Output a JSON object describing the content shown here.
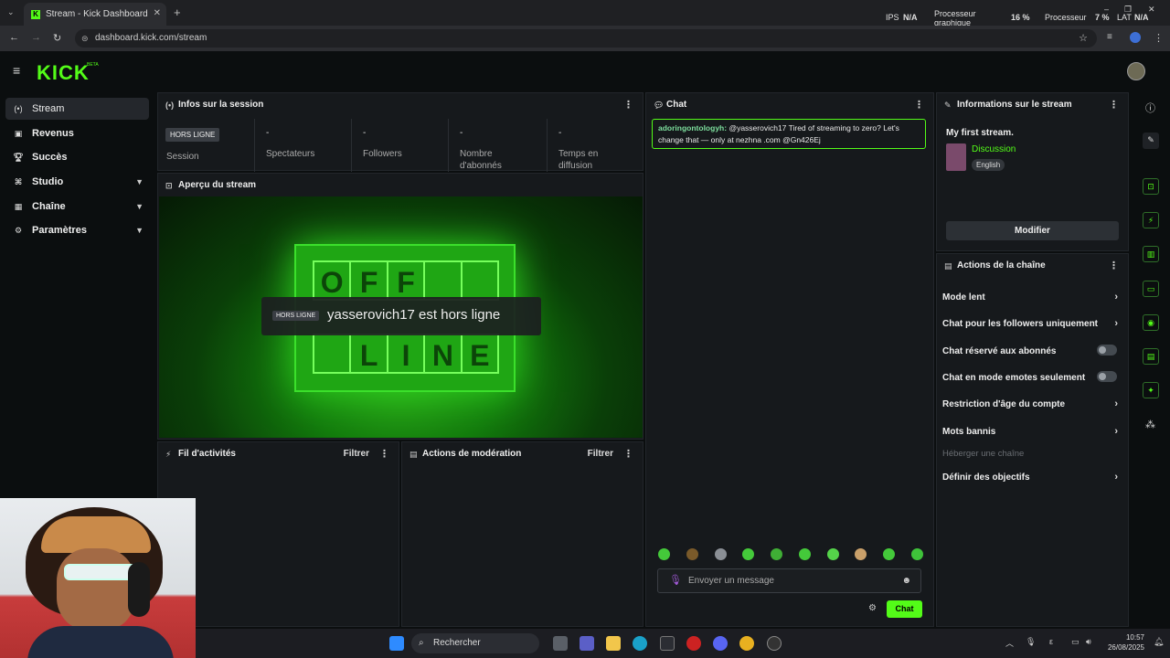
{
  "browser": {
    "tab_title": "Stream - Kick Dashboard",
    "url": "dashboard.kick.com/stream",
    "perf": {
      "ips_label": "IPS",
      "ips_value": "N/A",
      "gpu_label": "Processeur graphique",
      "gpu_value": "16 %",
      "cpu_label": "Processeur",
      "cpu_value": "7 %",
      "lat_label": "LAT",
      "lat_value": "N/A"
    }
  },
  "app": {
    "logo": "KICK",
    "beta": "BETA"
  },
  "sidebar": {
    "items": [
      {
        "label": "Stream",
        "icon": "broadcast-icon"
      },
      {
        "label": "Revenus",
        "icon": "wallet-icon"
      },
      {
        "label": "Succès",
        "icon": "trophy-icon"
      },
      {
        "label": "Studio",
        "icon": "studio-icon"
      },
      {
        "label": "Chaîne",
        "icon": "channel-icon"
      },
      {
        "label": "Paramètres",
        "icon": "gear-icon"
      }
    ]
  },
  "session": {
    "title": "Infos sur la session",
    "badge": "HORS LIGNE",
    "session_label": "Session",
    "stats": [
      {
        "value": "-",
        "label": "Spectateurs"
      },
      {
        "value": "-",
        "label": "Followers"
      },
      {
        "value": "-",
        "label": "Nombre d'abonnés"
      },
      {
        "value": "-",
        "label": "Temps en diffusion"
      }
    ]
  },
  "preview": {
    "title": "Aperçu du stream",
    "sign_top": [
      "O",
      "F",
      "F",
      "",
      ""
    ],
    "sign_bottom": [
      "",
      "L",
      "I",
      "N",
      "E"
    ],
    "badge": "HORS LIGNE",
    "offline_text": "yasserovich17 est hors ligne"
  },
  "activity": {
    "title": "Fil d'activités",
    "filter": "Filtrer"
  },
  "moderation": {
    "title": "Actions de modération",
    "filter": "Filtrer"
  },
  "chat": {
    "title": "Chat",
    "message": {
      "user": "adoringontologyh:",
      "text": " @yasserovich17 Tired of streaming to zero? Let's change that — only at nezhna .com @Gn426Ej"
    },
    "input_placeholder": "Envoyer un message",
    "send_label": "Chat"
  },
  "stream_info": {
    "title": "Informations sur le stream",
    "stream_title": "My first stream.",
    "category": "Discussion",
    "language": "English",
    "edit_label": "Modifier"
  },
  "channel_actions": {
    "title": "Actions de la chaîne",
    "items": [
      {
        "label": "Mode lent",
        "kind": "arrow"
      },
      {
        "label": "Chat pour les followers uniquement",
        "kind": "arrow"
      },
      {
        "label": "Chat réservé aux abonnés",
        "kind": "toggle"
      },
      {
        "label": "Chat en mode emotes seulement",
        "kind": "toggle"
      },
      {
        "label": "Restriction d'âge du compte",
        "kind": "arrow"
      },
      {
        "label": "Mots bannis",
        "kind": "arrow"
      },
      {
        "label": "Héberger une chaîne",
        "kind": "disabled"
      },
      {
        "label": "Définir des objectifs",
        "kind": "arrow"
      }
    ]
  },
  "taskbar": {
    "search_label": "Rechercher",
    "time": "10:57",
    "date": "26/08/2025"
  }
}
